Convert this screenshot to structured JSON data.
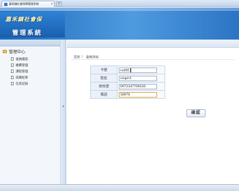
{
  "browser": {
    "tab_title": "嘉禾鎮社會保障管理系統",
    "tab_close": "×",
    "new_tab": "+"
  },
  "header": {
    "brand_line1": "嘉禾鎮社會保",
    "brand_line2": "管理系統"
  },
  "sidebar": {
    "title": "管理中心",
    "items": [
      {
        "label": "會員檔案"
      },
      {
        "label": "繳費管理"
      },
      {
        "label": "課程管理"
      },
      {
        "label": "成績結果"
      },
      {
        "label": "信息記錄"
      }
    ]
  },
  "splitter": {
    "arrow": "◂"
  },
  "breadcrumb": {
    "home": "首頁",
    "sep": "〉",
    "current": "會員添加"
  },
  "form": {
    "fields": [
      {
        "label": "卡號",
        "value": "no001"
      },
      {
        "label": "姓名",
        "value": "xiegm1"
      },
      {
        "label": "身份證",
        "value": "097234770943​0"
      },
      {
        "label": "電話",
        "value": "18976"
      }
    ],
    "confirm_label": "確認"
  }
}
